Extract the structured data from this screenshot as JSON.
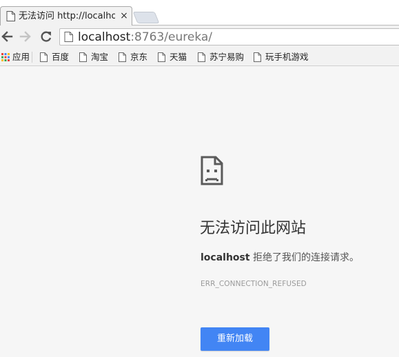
{
  "tab": {
    "title": "无法访问 http://localhost",
    "close_glyph": "×",
    "icon": "document-icon"
  },
  "toolbar": {
    "back_icon": "back-arrow-icon",
    "forward_icon": "forward-arrow-icon",
    "reload_icon": "reload-icon",
    "url_host": "localhost",
    "url_rest": ":8763/eureka/"
  },
  "bookmarks": {
    "apps_label": "应用",
    "items": [
      {
        "label": "百度"
      },
      {
        "label": "淘宝"
      },
      {
        "label": "京东"
      },
      {
        "label": "天猫"
      },
      {
        "label": "苏宁易购"
      },
      {
        "label": "玩手机游戏"
      }
    ]
  },
  "error": {
    "icon": "sad-document-icon",
    "title": "无法访问此网站",
    "host": "localhost",
    "message": " 拒绝了我们的连接请求。",
    "code": "ERR_CONNECTION_REFUSED",
    "reload_label": "重新加载"
  },
  "colors": {
    "accent": "#4285f4",
    "background": "#f6f6f6"
  }
}
